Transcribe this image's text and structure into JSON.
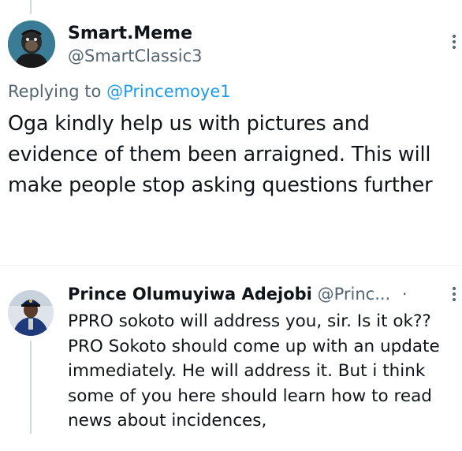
{
  "original_tweet": {
    "display_name": "Smart.Meme",
    "handle": "@SmartClassic3",
    "replying_prefix": "Replying to",
    "replying_to": "@Princemoye1",
    "text": "Oga kindly help us with pictures and evidence of them been arraigned. This will make people stop asking questions further"
  },
  "reply_tweet": {
    "display_name": "Prince Olumuyiwa Adejobi",
    "handle_truncated": "@Princ...",
    "separator": "·",
    "text": "PPRO sokoto will address you, sir. Is it ok?? PRO Sokoto should come up with an update immediately.  He will address it. But i think some of you here should learn how to read news about incidences,"
  },
  "colors": {
    "text_primary": "#0f1419",
    "text_secondary": "#536471",
    "link": "#1d9bf0",
    "thread_line": "#cfd9de"
  },
  "icons": {
    "more": "more-vertical-icon"
  }
}
